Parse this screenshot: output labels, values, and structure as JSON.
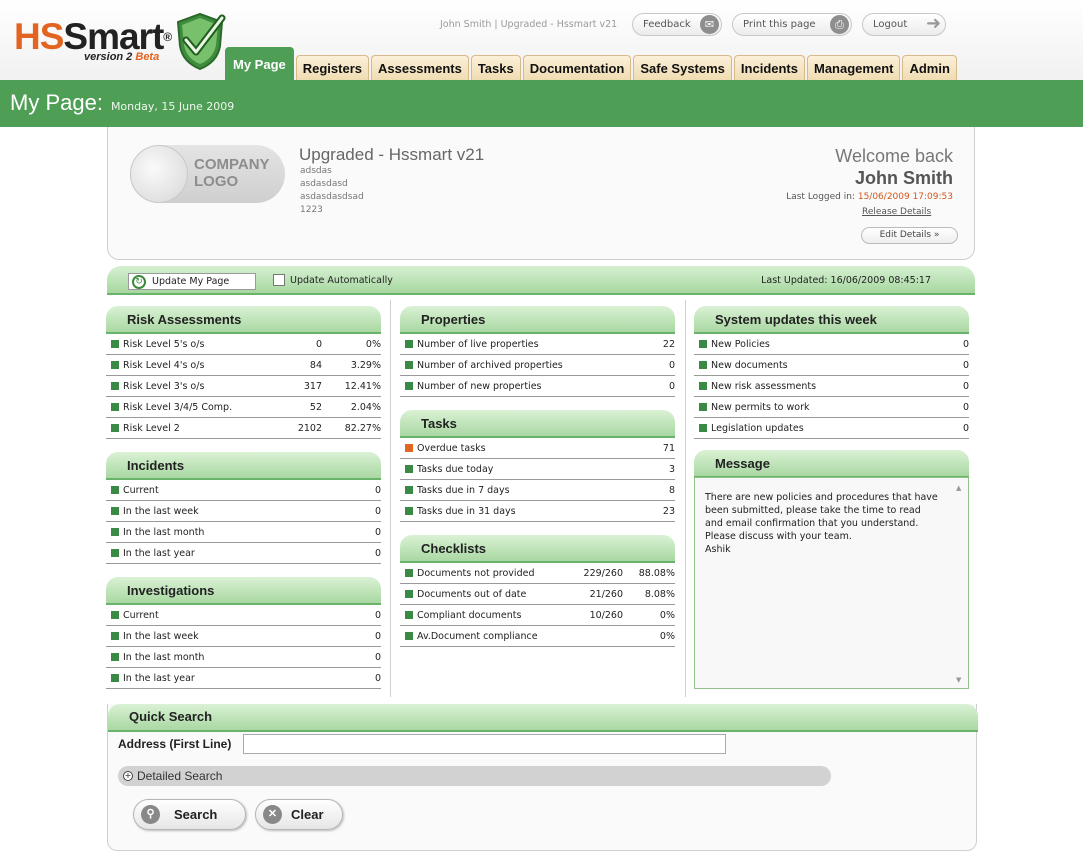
{
  "app": {
    "logo_hs": "HS",
    "logo_smart": "Smart",
    "logo_reg": "®",
    "version": "version 2",
    "beta": "Beta"
  },
  "header": {
    "userline": "John Smith | Upgraded - Hssmart v21",
    "feedback": "Feedback",
    "print": "Print this page",
    "logout": "Logout"
  },
  "tabs": [
    {
      "label": "My Page"
    },
    {
      "label": "Registers"
    },
    {
      "label": "Assessments"
    },
    {
      "label": "Tasks"
    },
    {
      "label": "Documentation"
    },
    {
      "label": "Safe Systems"
    },
    {
      "label": "Incidents"
    },
    {
      "label": "Management"
    },
    {
      "label": "Admin"
    }
  ],
  "page": {
    "title": "My Page:",
    "date": "Monday, 15 June 2009"
  },
  "company": {
    "logo_line1": "COMPANY",
    "logo_line2": "LOGO",
    "name": "Upgraded - Hssmart v21",
    "address": [
      "adsdas",
      "asdasdasd",
      "asdasdasdsad",
      "1223"
    ],
    "welcome": "Welcome back",
    "user": "John Smith",
    "last_logged_label": "Last Logged in:",
    "last_logged": "15/06/2009 17:09:53",
    "release": "Release Details",
    "edit": "Edit Details »"
  },
  "update": {
    "button": "Update My Page",
    "auto_label": "Update Automatically",
    "last_updated": "Last Updated: 16/06/2009 08:45:17"
  },
  "risk": {
    "title": "Risk Assessments",
    "rows": [
      {
        "label": "Risk Level 5's o/s",
        "count": "0",
        "pct": "0%"
      },
      {
        "label": "Risk Level 4's o/s",
        "count": "84",
        "pct": "3.29%"
      },
      {
        "label": "Risk Level 3's o/s",
        "count": "317",
        "pct": "12.41%"
      },
      {
        "label": "Risk Level 3/4/5 Comp.",
        "count": "52",
        "pct": "2.04%"
      },
      {
        "label": "Risk Level 2",
        "count": "2102",
        "pct": "82.27%"
      }
    ]
  },
  "incidents": {
    "title": "Incidents",
    "rows": [
      {
        "label": "Current",
        "count": "0"
      },
      {
        "label": "In the last week",
        "count": "0"
      },
      {
        "label": "In the last month",
        "count": "0"
      },
      {
        "label": "In the last year",
        "count": "0"
      }
    ]
  },
  "investigations": {
    "title": "Investigations",
    "rows": [
      {
        "label": "Current",
        "count": "0"
      },
      {
        "label": "In the last week",
        "count": "0"
      },
      {
        "label": "In the last month",
        "count": "0"
      },
      {
        "label": "In the last year",
        "count": "0"
      }
    ]
  },
  "properties": {
    "title": "Properties",
    "rows": [
      {
        "label": "Number of live properties",
        "count": "22"
      },
      {
        "label": "Number of archived properties",
        "count": "0"
      },
      {
        "label": "Number of new properties",
        "count": "0"
      }
    ]
  },
  "tasks": {
    "title": "Tasks",
    "rows": [
      {
        "label": "Overdue tasks",
        "count": "71",
        "color": "#e2661f"
      },
      {
        "label": "Tasks due today",
        "count": "3"
      },
      {
        "label": "Tasks due in 7 days",
        "count": "8"
      },
      {
        "label": "Tasks due in 31 days",
        "count": "23"
      }
    ]
  },
  "checklists": {
    "title": "Checklists",
    "rows": [
      {
        "label": "Documents not provided",
        "count": "229/260",
        "pct": "88.08%"
      },
      {
        "label": "Documents out of date",
        "count": "21/260",
        "pct": "8.08%"
      },
      {
        "label": "Compliant documents",
        "count": "10/260",
        "pct": "0%"
      },
      {
        "label": "Av.Document compliance",
        "count": "",
        "pct": "0%"
      }
    ]
  },
  "system": {
    "title": "System updates this week",
    "rows": [
      {
        "label": "New Policies",
        "count": "0"
      },
      {
        "label": "New documents",
        "count": "0"
      },
      {
        "label": "New risk assessments",
        "count": "0"
      },
      {
        "label": "New permits to work",
        "count": "0"
      },
      {
        "label": "Legislation updates",
        "count": "0"
      }
    ]
  },
  "message": {
    "title": "Message",
    "text": "There are new policies and procedures that have been submitted, please take the time to read and email confirmation that you understand.  Please discuss with your team.",
    "signature": "Ashik"
  },
  "quicksearch": {
    "title": "Quick Search",
    "address_label": "Address (First Line)",
    "address_value": "",
    "detailed": "Detailed Search",
    "search": "Search",
    "clear": "Clear"
  },
  "colors": {
    "brand_green": "#4e9e55",
    "accent_orange": "#e26420",
    "tab_beige": "#efdcb1"
  }
}
